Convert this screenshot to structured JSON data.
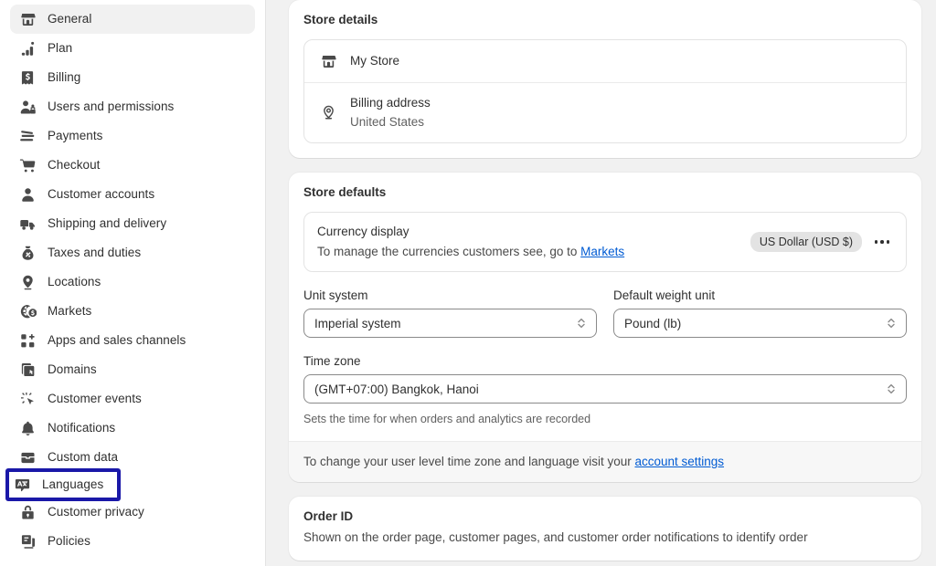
{
  "sidebar": {
    "items": [
      {
        "label": "General",
        "icon": "store-icon",
        "active": true,
        "highlighted": false
      },
      {
        "label": "Plan",
        "icon": "chart-bar-icon",
        "active": false,
        "highlighted": false
      },
      {
        "label": "Billing",
        "icon": "bill-icon",
        "active": false,
        "highlighted": false
      },
      {
        "label": "Users and permissions",
        "icon": "users-icon",
        "active": false,
        "highlighted": false
      },
      {
        "label": "Payments",
        "icon": "payments-icon",
        "active": false,
        "highlighted": false
      },
      {
        "label": "Checkout",
        "icon": "cart-icon",
        "active": false,
        "highlighted": false
      },
      {
        "label": "Customer accounts",
        "icon": "person-icon",
        "active": false,
        "highlighted": false
      },
      {
        "label": "Shipping and delivery",
        "icon": "truck-icon",
        "active": false,
        "highlighted": false
      },
      {
        "label": "Taxes and duties",
        "icon": "money-bag-icon",
        "active": false,
        "highlighted": false
      },
      {
        "label": "Locations",
        "icon": "location-pin-icon",
        "active": false,
        "highlighted": false
      },
      {
        "label": "Markets",
        "icon": "globe-dollar-icon",
        "active": false,
        "highlighted": false
      },
      {
        "label": "Apps and sales channels",
        "icon": "apps-grid-plus-icon",
        "active": false,
        "highlighted": false
      },
      {
        "label": "Domains",
        "icon": "domains-icon",
        "active": false,
        "highlighted": false
      },
      {
        "label": "Customer events",
        "icon": "click-sparkle-icon",
        "active": false,
        "highlighted": false
      },
      {
        "label": "Notifications",
        "icon": "bell-icon",
        "active": false,
        "highlighted": false
      },
      {
        "label": "Custom data",
        "icon": "database-icon",
        "active": false,
        "highlighted": false
      },
      {
        "label": "Languages",
        "icon": "languages-icon",
        "active": false,
        "highlighted": true
      },
      {
        "label": "Customer privacy",
        "icon": "lock-icon",
        "active": false,
        "highlighted": false
      },
      {
        "label": "Policies",
        "icon": "policies-icon",
        "active": false,
        "highlighted": false
      }
    ],
    "highlight_color": "#1a18a8",
    "active_background": "#f1f1f1"
  },
  "store_details": {
    "title": "Store details",
    "store_name": "My Store",
    "billing_address_label": "Billing address",
    "billing_address_value": "United States"
  },
  "store_defaults": {
    "title": "Store defaults",
    "currency": {
      "heading": "Currency display",
      "description_prefix": "To manage the currencies customers see, go to ",
      "link_label": "Markets",
      "badge": "US Dollar (USD $)",
      "more_label": "More actions"
    },
    "unit_system": {
      "label": "Unit system",
      "value": "Imperial system"
    },
    "weight_unit": {
      "label": "Default weight unit",
      "value": "Pound (lb)"
    },
    "time_zone": {
      "label": "Time zone",
      "value": "(GMT+07:00) Bangkok, Hanoi",
      "helper": "Sets the time for when orders and analytics are recorded"
    },
    "footer": {
      "text_prefix": "To change your user level time zone and language visit your ",
      "link_label": "account settings"
    }
  },
  "order_id": {
    "title": "Order ID",
    "description": "Shown on the order page, customer pages, and customer order notifications to identify order"
  },
  "colors": {
    "link": "#005bd3",
    "text_primary": "#303030",
    "text_secondary": "#616161",
    "page_background": "#f1f1f1"
  }
}
